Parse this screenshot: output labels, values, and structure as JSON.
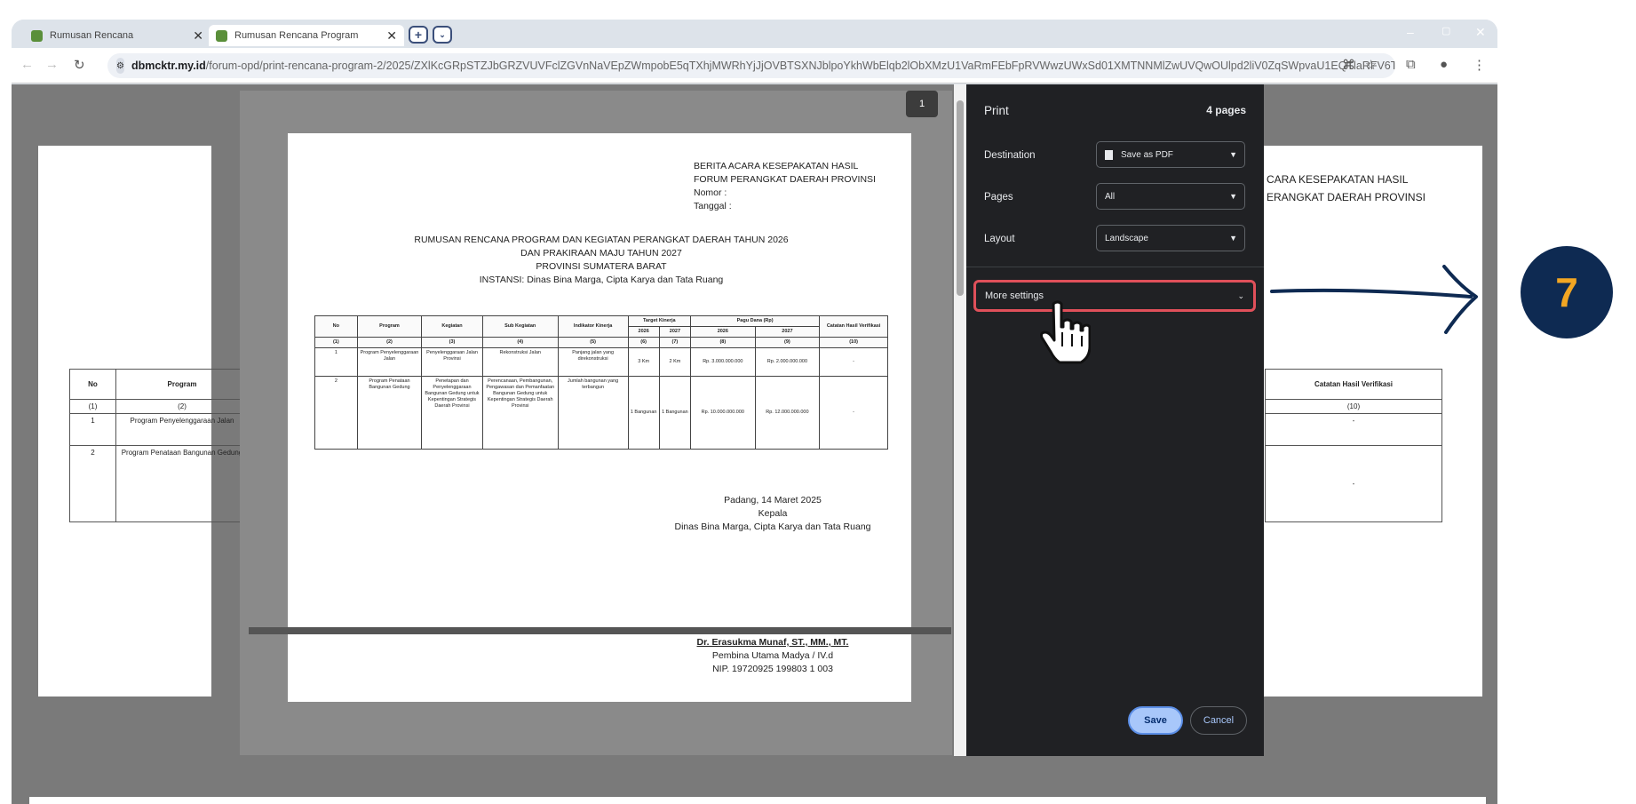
{
  "browser": {
    "tabs": [
      {
        "label": "Rumusan Rencana"
      },
      {
        "label": "Rumusan Rencana Program"
      }
    ],
    "new_tab": "+",
    "url_host": "dbmcktr.my.id",
    "url_path": "/forum-opd/print-rencana-program-2/2025/ZXlKcGRpSTZJbGRZVUVFclZGVnNaVEpZWmpobE5qTXhjMWRhYjJjOVBTSXNJblpoYkhWbElqb2lObXMzU1VaRmFEbFpRVWwzUWxSd01XMTNNMlZwUVQwOUlpd2liV0ZqSWpvaU1EQTlaRFV6T..."
  },
  "background_page": {
    "header_lines": [
      "CARA KESEPAKATAN HASIL",
      "ERANGKAT DAERAH PROVINSI"
    ],
    "left_table": {
      "headers": [
        "No",
        "Program"
      ],
      "subheaders": [
        "(1)",
        "(2)"
      ],
      "rows": [
        [
          "1",
          "Program Penyelenggaraan Jalan"
        ],
        [
          "2",
          "Program Penataan Bangunan Gedung"
        ]
      ]
    },
    "right_table": {
      "header": "Catatan Hasil Verifikasi",
      "subheader": "(10)",
      "rows": [
        "-",
        "-"
      ]
    }
  },
  "document": {
    "page_number": "1",
    "header_lines": [
      "BERITA ACARA KESEPAKATAN HASIL",
      "FORUM PERANGKAT DAERAH PROVINSI",
      "Nomor :",
      "Tanggal :"
    ],
    "title_lines": [
      "RUMUSAN RENCANA PROGRAM DAN KEGIATAN PERANGKAT DAERAH TAHUN 2026",
      "DAN PRAKIRAAN MAJU TAHUN 2027",
      "PROVINSI SUMATERA BARAT",
      "INSTANSI: Dinas Bina Marga, Cipta Karya dan Tata Ruang"
    ],
    "table": {
      "headers": [
        "No",
        "Program",
        "Kegiatan",
        "Sub Kegiatan",
        "Indikator Kinerja",
        "Target Kinerja",
        "Pagu Dana (Rp)",
        "Catatan Hasil Verifikasi"
      ],
      "year_headers": [
        "2026",
        "2027",
        "2026",
        "2027"
      ],
      "index_row": [
        "(1)",
        "(2)",
        "(3)",
        "(4)",
        "(5)",
        "(6)",
        "(7)",
        "(8)",
        "(9)",
        "(10)"
      ],
      "rows": [
        [
          "1",
          "Program Penyelenggaraan Jalan",
          "Penyelenggaraan Jalan Provinsi",
          "Rekonstruksi Jalan",
          "Panjang jalan yang direkonstruksi",
          "3 Km",
          "2 Km",
          "Rp. 3.000.000.000",
          "Rp. 2.000.000.000",
          "-"
        ],
        [
          "2",
          "Program Penataan Bangunan Gedung",
          "Penetapan dan Penyelenggaraan Bangunan Gedung untuk Kepentingan Strategis Daerah Provinsi",
          "Perencanaan, Pembangunan, Pengawasan dan Pemanfaatan Bangunan Gedung untuk Kepentingan Strategis Daerah Provinsi",
          "Jumlah bangunan yang terbangun",
          "1 Bangunan",
          "1 Bangunan",
          "Rp. 10.000.000.000",
          "Rp. 12.000.000.000",
          "-"
        ]
      ]
    },
    "sign_lines": [
      "Padang, 14 Maret 2025",
      "Kepala",
      "Dinas Bina Marga, Cipta Karya dan Tata Ruang"
    ],
    "signer_name": "Dr. Erasukma Munaf, ST., MM., MT.",
    "signer_lines": [
      "Pembina Utama Madya / IV.d",
      "NIP. 19720925 199803 1 003"
    ]
  },
  "print_panel": {
    "title": "Print",
    "page_count": "4 pages",
    "destination_label": "Destination",
    "destination_value": "Save as PDF",
    "pages_label": "Pages",
    "pages_value": "All",
    "layout_label": "Layout",
    "layout_value": "Landscape",
    "more_settings": "More settings",
    "save": "Save",
    "cancel": "Cancel"
  },
  "annotation": {
    "step_number": "7",
    "highlight_color": "#e0505a",
    "badge_color": "#0e2a52",
    "badge_text_color": "#f2a623"
  }
}
